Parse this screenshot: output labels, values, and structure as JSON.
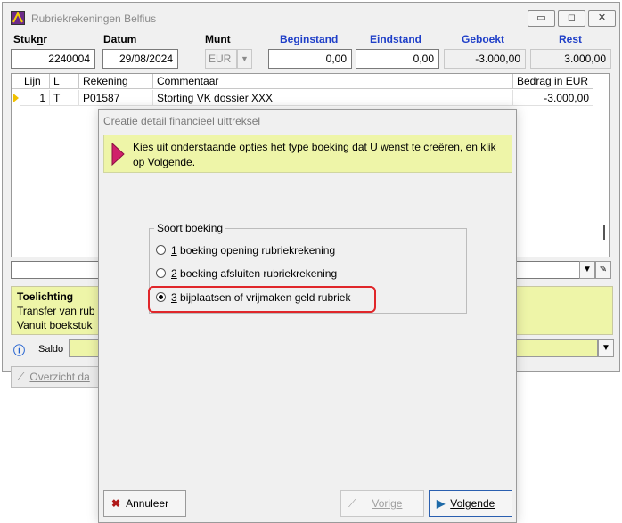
{
  "window": {
    "title": "Rubriekrekeningen Belfius",
    "minimize_icon": "minimize-icon",
    "maximize_icon": "maximize-icon",
    "close_icon": "close-icon",
    "minimize_glyph": "▭",
    "maximize_glyph": "◻",
    "close_glyph": "✕"
  },
  "header": {
    "labels": {
      "stuknr_pre": "Stuk",
      "stuknr_accel": "n",
      "stuknr_post": "r",
      "datum": "Datum",
      "munt": "Munt",
      "beginstand": "Beginstand",
      "eindstand": "Eindstand",
      "geboekt": "Geboekt",
      "rest": "Rest"
    },
    "values": {
      "stuknr": "2240004",
      "datum": "29/08/2024",
      "munt": "EUR",
      "beginstand": "0,00",
      "eindstand": "0,00",
      "geboekt": "-3.000,00",
      "rest": "3.000,00"
    },
    "accent_blue": "#1f3fc8"
  },
  "grid": {
    "columns": [
      "Lijn",
      "L",
      "Rekening",
      "Commentaar",
      "Bedrag in EUR"
    ],
    "rows": [
      {
        "lijn": "1",
        "l": "T",
        "rekening": "P01587",
        "commentaar": "Storting VK dossier XXX",
        "bedrag": "-3.000,00"
      }
    ]
  },
  "toelichting": {
    "title": "Toelichting",
    "line1": "Transfer van rub",
    "line2": "Vanuit boekstuk"
  },
  "saldo": {
    "label": "Saldo"
  },
  "overzicht_button": "Overzicht da",
  "dialog": {
    "title": "Creatie detail financieel uittreksel",
    "intro": "Kies uit onderstaande opties het type boeking dat U wenst te creëren, en klik op Volgende.",
    "group_label": "Soort boeking",
    "options": [
      {
        "accel": "1",
        "text": " boeking opening rubriekrekening",
        "checked": false
      },
      {
        "accel": "2",
        "text": " boeking afsluiten rubriekrekening",
        "checked": false
      },
      {
        "accel": "3",
        "text": " bijplaatsen of vrijmaken geld rubriek",
        "checked": true
      }
    ],
    "buttons": {
      "annuleer": "Annuleer",
      "vorige": "Vorige",
      "volgende": "Volgende"
    },
    "highlight_color": "#e0262a",
    "panel_color": "#eef5a8",
    "arrow_color": "#d0206a"
  }
}
